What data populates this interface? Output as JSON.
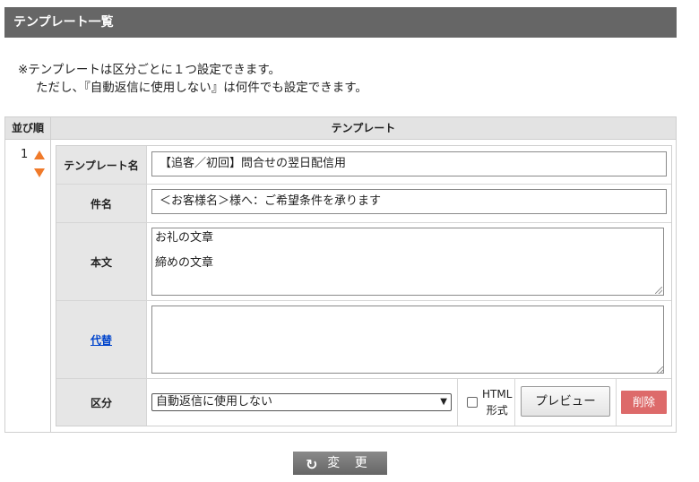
{
  "header": {
    "title": "テンプレート一覧"
  },
  "notice": {
    "line1": "※テンプレートは区分ごとに１つ設定できます。",
    "line2": "ただし、『自動返信に使用しない』は何件でも設定できます。"
  },
  "table": {
    "col_order": "並び順",
    "col_template": "テンプレート",
    "order_number": "1"
  },
  "form": {
    "template_name_label": "テンプレート名",
    "template_name_value": "【追客／初回】問合せの翌日配信用",
    "subject_label": "件名",
    "subject_value": "＜お客様名＞様へ：ご希望条件を承ります",
    "body_label": "本文",
    "body_line1": "お礼の文章",
    "body_line2": "締めの文章",
    "alt_label": "代替",
    "alt_value": "",
    "category_label": "区分",
    "category_selected": "自動返信に使用しない",
    "html_label_1": "HTML",
    "html_label_2": "形式",
    "preview_label": "プレビュー",
    "delete_label": "削除"
  },
  "footer": {
    "change_label": "変 更"
  },
  "colors": {
    "header_bg": "#666666",
    "arrow": "#f07a2a",
    "delete_bg": "#dd6a6a",
    "link": "#0044cc"
  },
  "icons": {
    "move_up": "triangle-up-icon",
    "move_down": "triangle-down-icon",
    "change": "refresh-icon",
    "select": "chevron-down-icon"
  }
}
